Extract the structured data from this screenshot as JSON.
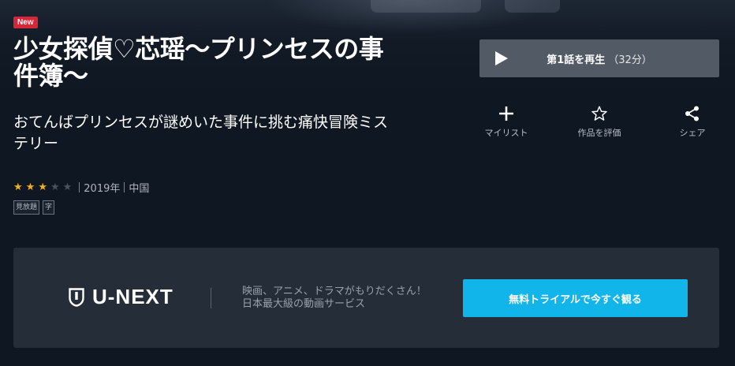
{
  "badge": "New",
  "title": "少女探偵♡芯瑶〜プリンセスの事件簿〜",
  "subtitle": "おてんばプリンセスが謎めいた事件に挑む痛快冒険ミステリー",
  "rating": {
    "stars": 3,
    "max": 5,
    "year": "2019年",
    "country": "中国"
  },
  "tags": [
    "見放題",
    "字"
  ],
  "play": {
    "label": "第1話を再生",
    "duration": "（32分）"
  },
  "actions": [
    {
      "icon": "plus-icon",
      "label": "マイリスト"
    },
    {
      "icon": "star-outline-icon",
      "label": "作品を評価"
    },
    {
      "icon": "share-icon",
      "label": "シェア"
    }
  ],
  "banner": {
    "logo_text": "U-NEXT",
    "tagline_1": "映画、アニメ、ドラマがもりだくさん！",
    "tagline_2": "日本最大級の動画サービス",
    "cta": "無料トライアルで今すぐ観る"
  },
  "colors": {
    "accent": "#12b5ea",
    "badge": "#d72638",
    "star": "#f2b21d",
    "background": "#0f1722",
    "banner": "#252d39"
  }
}
